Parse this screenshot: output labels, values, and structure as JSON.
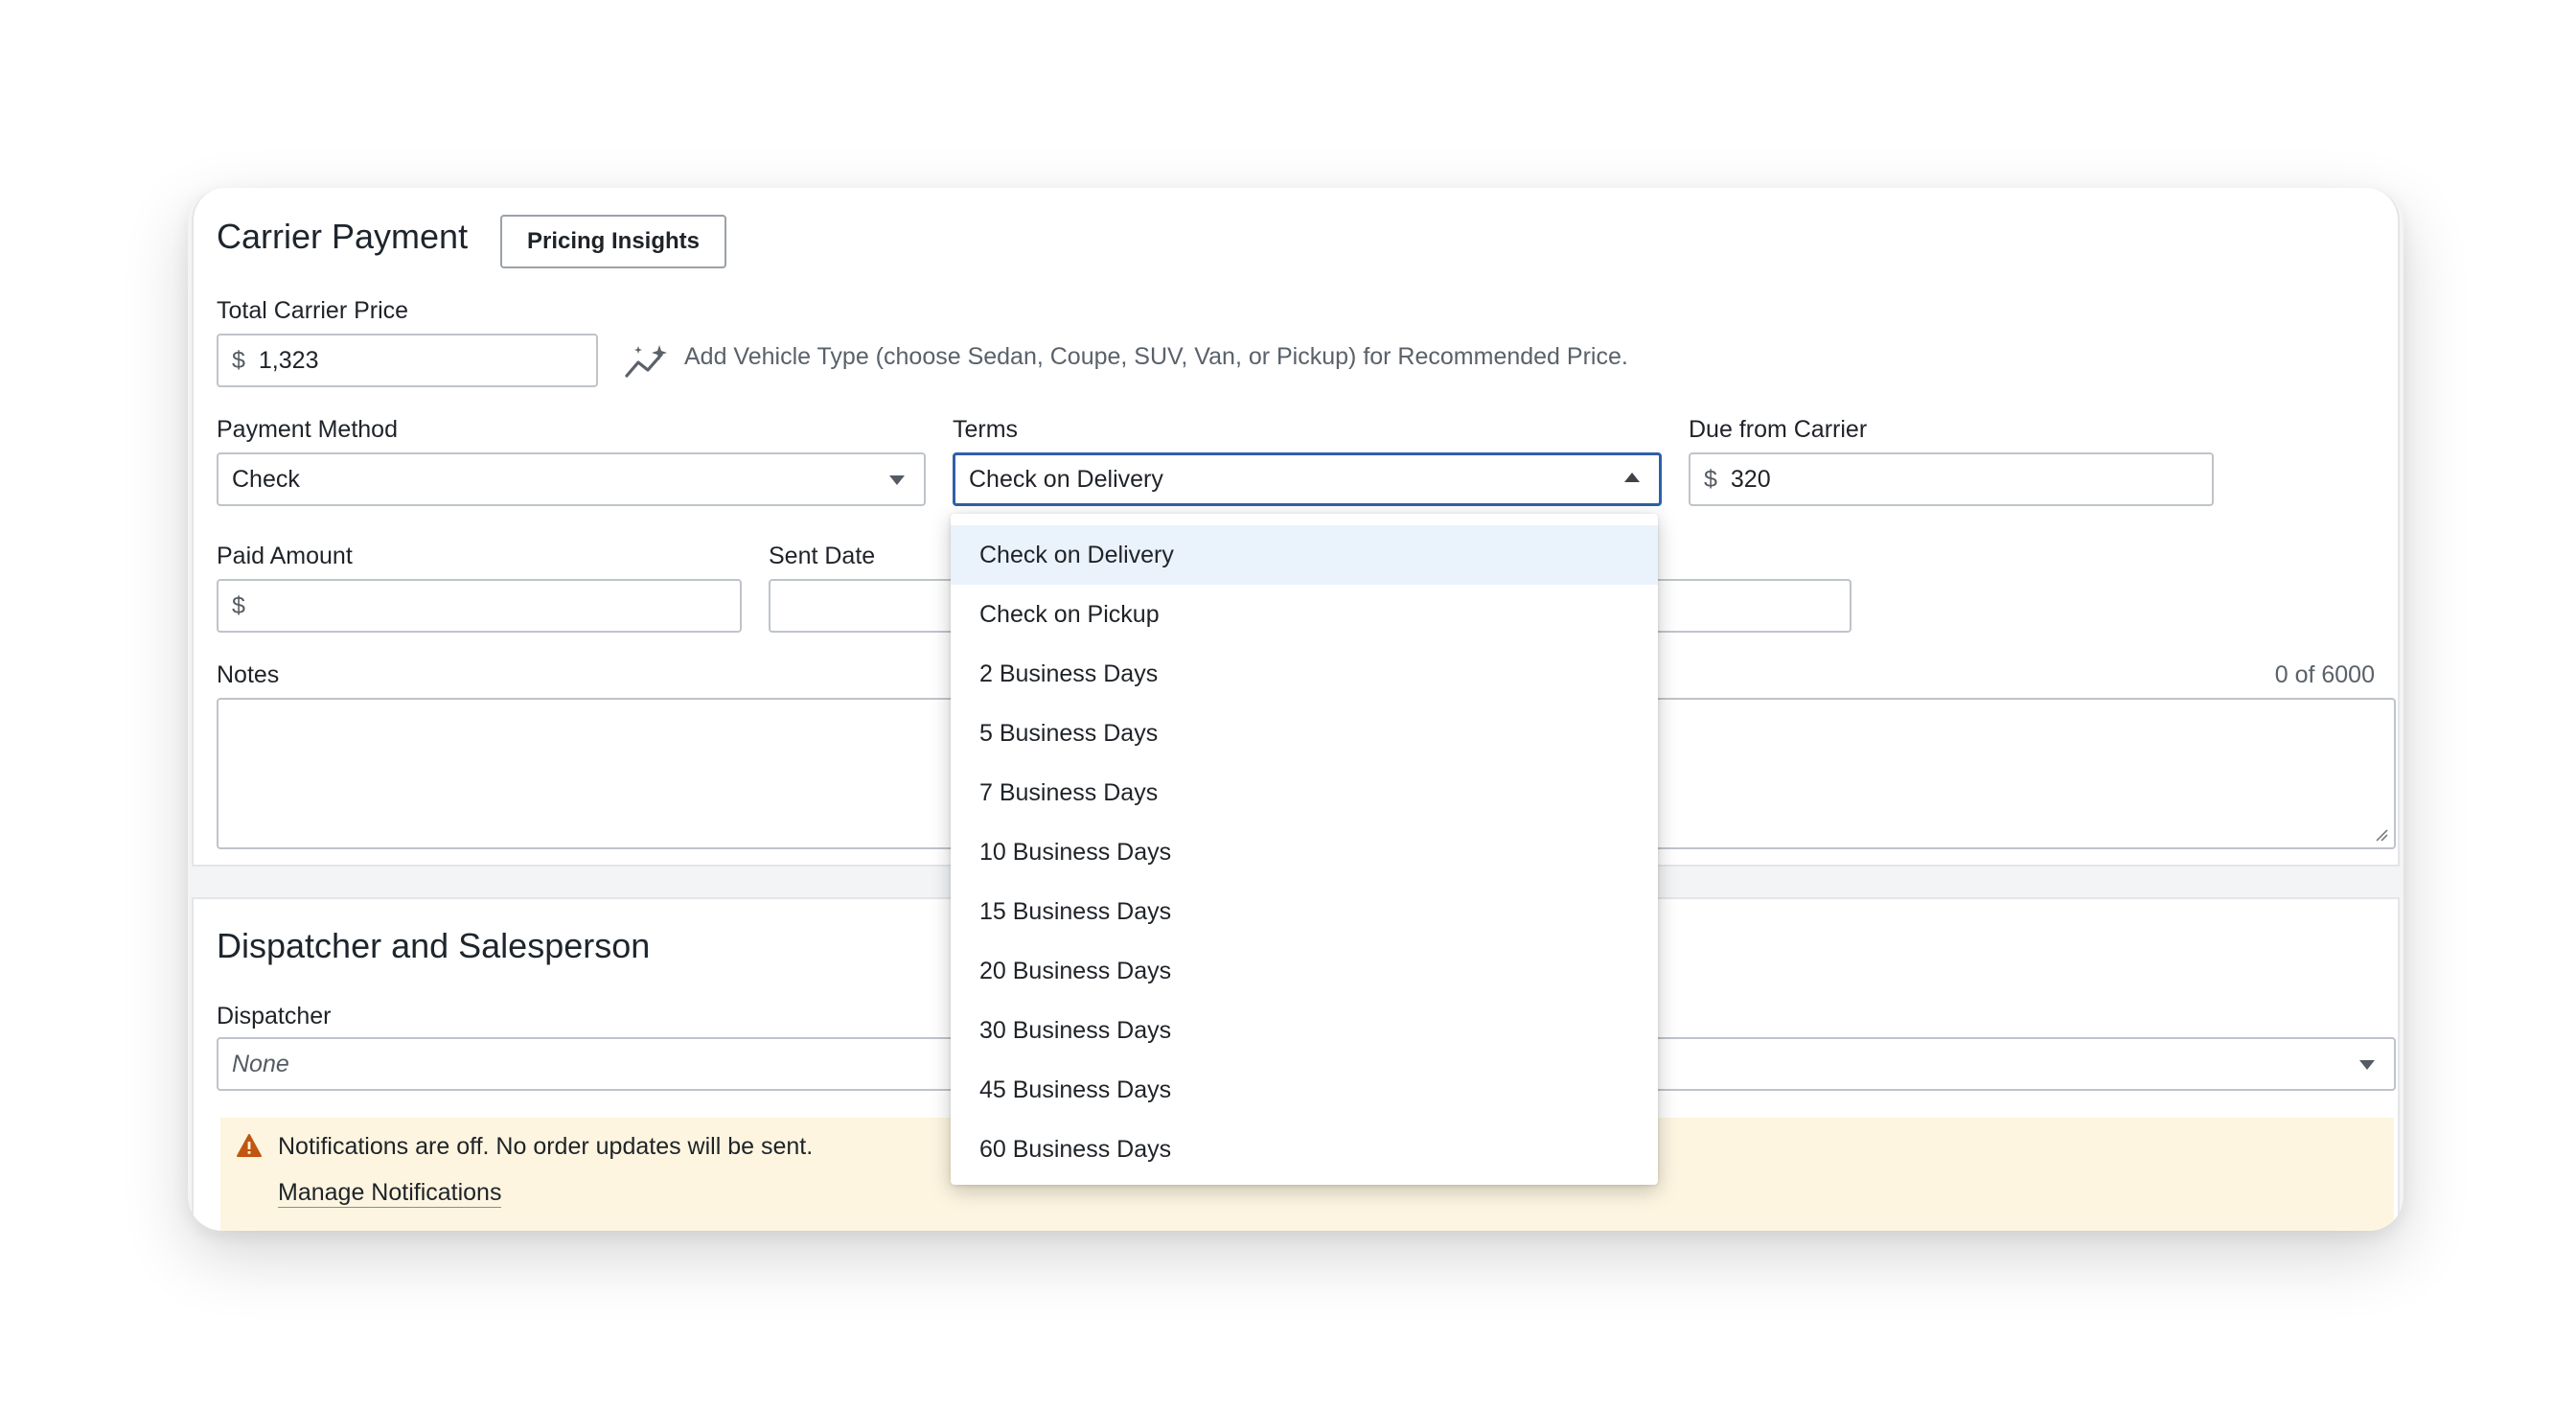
{
  "carrier_payment": {
    "title": "Carrier Payment",
    "pricing_insights_button": "Pricing Insights",
    "total_carrier_price": {
      "label": "Total Carrier Price",
      "currency": "$",
      "value": "1,323"
    },
    "recommendation_hint": "Add Vehicle Type (choose Sedan, Coupe, SUV, Van, or Pickup) for Recommended Price.",
    "payment_method": {
      "label": "Payment Method",
      "value": "Check"
    },
    "terms": {
      "label": "Terms",
      "value": "Check on Delivery",
      "options": [
        "Check on Delivery",
        "Check on Pickup",
        "2 Business Days",
        "5 Business Days",
        "7 Business Days",
        "10 Business Days",
        "15 Business Days",
        "20 Business Days",
        "30 Business Days",
        "45 Business Days",
        "60 Business Days"
      ]
    },
    "due_from_carrier": {
      "label": "Due from Carrier",
      "currency": "$",
      "value": "320"
    },
    "paid_amount": {
      "label": "Paid Amount",
      "currency": "$",
      "value": ""
    },
    "sent_date": {
      "label": "Sent Date",
      "value": ""
    },
    "notes": {
      "label": "Notes",
      "counter": "0 of 6000"
    }
  },
  "dispatcher_section": {
    "title": "Dispatcher and Salesperson",
    "dispatcher": {
      "label": "Dispatcher",
      "value": "None"
    },
    "notification_banner": {
      "message": "Notifications are off. No order updates will be sent.",
      "link": "Manage Notifications"
    }
  },
  "colors": {
    "focus_border": "#2f5fa8",
    "active_option_bg": "#eaf2fb",
    "warning_bg": "#fdf5e0",
    "warning_icon": "#c0560f"
  }
}
